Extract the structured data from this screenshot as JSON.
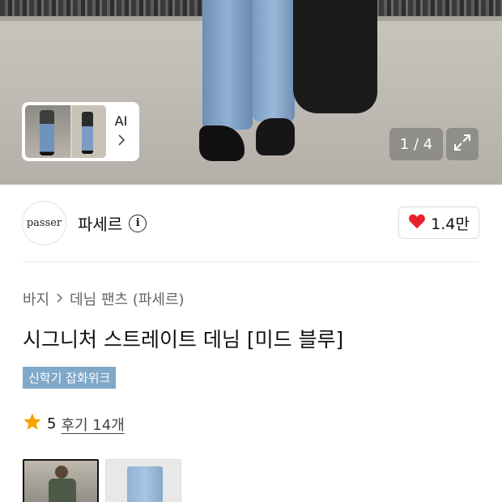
{
  "gallery": {
    "ai_label": "AI",
    "counter": "1 / 4"
  },
  "seller": {
    "logo_text": "passer",
    "name": "파세르",
    "likes": "1.4만",
    "heart_color": "#e8202a"
  },
  "product": {
    "breadcrumb": [
      "바지",
      "데님 팬츠 (파세르)"
    ],
    "title": "시그니처 스트레이트 데님 [미드 블루]",
    "tag": "신학기 잡화위크",
    "tag_color": "#7fa8c9",
    "rating": "5",
    "reviews": "후기 14개",
    "star_color": "#f4a300"
  },
  "icons": {
    "info": "info-icon",
    "heart": "heart-icon",
    "star": "star-icon",
    "chevron": "chevron-right-icon",
    "expand": "expand-icon"
  }
}
